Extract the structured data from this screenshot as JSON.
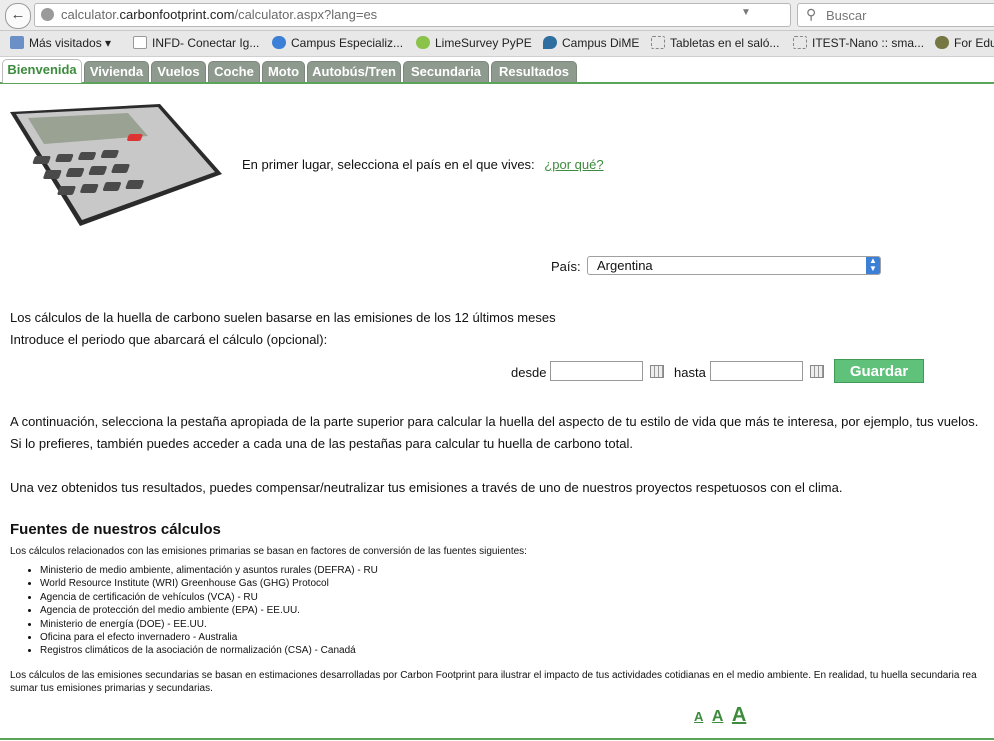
{
  "browser": {
    "url_prefix": "calculator.",
    "url_domain": "carbonfootprint.com",
    "url_path": "/calculator.aspx?lang=es",
    "search_placeholder": "Buscar"
  },
  "bookmarks": [
    {
      "label": "Más visitados ▾",
      "icon": "folder-icon",
      "color": "#6b8fc7"
    },
    {
      "label": "INFD- Conectar Ig...",
      "icon": "page-icon",
      "color": "#cc3333"
    },
    {
      "label": "Campus Especializ...",
      "icon": "campus-icon",
      "color": "#3b7fd6"
    },
    {
      "label": "LimeSurvey PyPE",
      "icon": "lime-icon",
      "color": "#8bc34a"
    },
    {
      "label": "Campus DiME",
      "icon": "drop-icon",
      "color": "#2f6f9f"
    },
    {
      "label": "Tabletas en el saló...",
      "icon": "dotted-page-icon",
      "color": "#999999"
    },
    {
      "label": "ITEST-Nano :: sma...",
      "icon": "dotted-page-icon",
      "color": "#999999"
    },
    {
      "label": "For Edu",
      "icon": "gear-icon",
      "color": "#777744"
    }
  ],
  "tabs": [
    "Bienvenida",
    "Vivienda",
    "Vuelos",
    "Coche",
    "Moto",
    "Autobús/Tren",
    "Secundaria",
    "Resultados"
  ],
  "intro": {
    "text": "En primer lugar, selecciona el país en el que vives:",
    "why_link": "¿por qué?"
  },
  "country": {
    "label": "País:",
    "value": "Argentina"
  },
  "period": {
    "line1": "Los cálculos de la huella de carbono suelen basarse en las emisiones de los 12 últimos meses",
    "line2": "Introduce el periodo que abarcará el cálculo (opcional):",
    "from_label": "desde",
    "to_label": "hasta",
    "save_label": "Guardar"
  },
  "instructions": {
    "p1": "A continuación, selecciona la pestaña apropiada de la parte superior para calcular la huella del aspecto de tu estilo de vida que más te interesa, por ejemplo, tus vuelos.",
    "p2": "Si lo prefieres, también puedes acceder a cada una de las pestañas para calcular tu huella de carbono total.",
    "p3": "Una vez obtenidos tus resultados, puedes compensar/neutralizar tus emisiones a través de uno de nuestros proyectos respetuosos con el clima."
  },
  "sources": {
    "title": "Fuentes de nuestros cálculos",
    "intro": "Los cálculos relacionados con las emisiones primarias se basan en factores de conversión de las fuentes siguientes:",
    "items": [
      "Ministerio de medio ambiente, alimentación y asuntos rurales (DEFRA) - RU",
      "World Resource Institute (WRI) Greenhouse Gas (GHG) Protocol",
      "Agencia de certificación de vehículos (VCA) - RU",
      "Agencia de protección del medio ambiente (EPA) - EE.UU.",
      "Ministerio de energía (DOE) - EE.UU.",
      "Oficina para el efecto invernadero - Australia",
      "Registros climáticos de la asociación de normalización (CSA) - Canadá"
    ],
    "secondary_line1": "Los cálculos de las emisiones secundarias se basan en estimaciones desarrolladas por Carbon Footprint para ilustrar el impacto de tus actividades cotidianas en el medio ambiente. En realidad, tu huella secundaria rea",
    "secondary_line2": "sumar tus emisiones primarias y secundarias."
  },
  "font_size_controls": [
    "A",
    "A",
    "A"
  ]
}
